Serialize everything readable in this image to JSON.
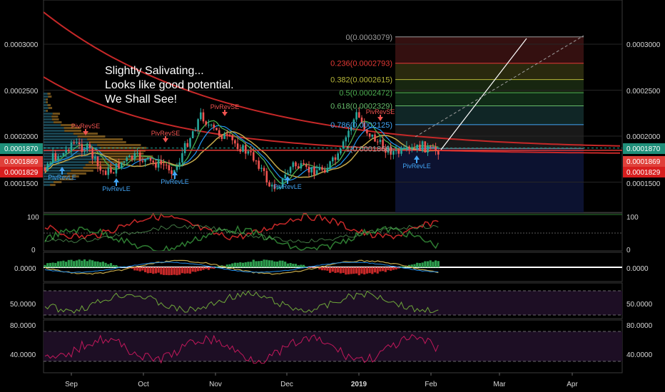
{
  "chart_data": {
    "type": "candlestick",
    "price_panel": {
      "ylim": [
        0.0001215,
        0.000361
      ],
      "yticks": [
        "0.0003000",
        "0.0002500",
        "0.0002000",
        "0.0001500"
      ],
      "current_price": "0.0001870",
      "price_labels": [
        "0.0001870",
        "0.0001869",
        "0.0001829"
      ],
      "annotation": [
        "Slightly Salivating...",
        "Looks like good potential.",
        "We Shall See!"
      ],
      "fib_levels": [
        {
          "label": "0(0.0003079)",
          "value": 0.0003079,
          "color": "#9e9e9e"
        },
        {
          "label": "0.236(0.0002793)",
          "value": 0.0002793,
          "color": "#e53935"
        },
        {
          "label": "0.382(0.0002615)",
          "value": 0.0002615,
          "color": "#b7b73a"
        },
        {
          "label": "0.5(0.0002472)",
          "value": 0.0002472,
          "color": "#4caf50"
        },
        {
          "label": "0.618(0.0002329)",
          "value": 0.0002329,
          "color": "#66bb6a"
        },
        {
          "label": "0.786(0.0002125)",
          "value": 0.0002125,
          "color": "#42a5f5"
        },
        {
          "label": "1(0.0001866)",
          "value": 0.0001866,
          "color": "#9e9e9e"
        }
      ],
      "signals": [
        {
          "label": "PivRevSE",
          "dir": "down",
          "x": 120,
          "y": 190
        },
        {
          "label": "PivRevSE",
          "dir": "down",
          "x": 232,
          "y": 200
        },
        {
          "label": "PivRevSE",
          "dir": "down",
          "x": 315,
          "y": 163
        },
        {
          "label": "PivRevSE",
          "dir": "down",
          "x": 533,
          "y": 170
        },
        {
          "label": "PivRevLE",
          "dir": "up",
          "x": 87,
          "y": 252
        },
        {
          "label": "PivRevLE",
          "dir": "up",
          "x": 163,
          "y": 268
        },
        {
          "label": "PivRevLE",
          "dir": "up",
          "x": 245,
          "y": 258
        },
        {
          "label": "PivRevLE",
          "dir": "up",
          "x": 403,
          "y": 265
        },
        {
          "label": "PivRevLE",
          "dir": "up",
          "x": 584,
          "y": 236
        }
      ]
    },
    "dmi_panel": {
      "ylim": [
        0,
        100
      ],
      "yticks": [
        "100",
        "0"
      ]
    },
    "macd_panel": {
      "yticks": [
        "0.0000"
      ]
    },
    "rsi_panel": {
      "yticks": [
        "50.0000"
      ]
    },
    "stoch_panel": {
      "yticks": [
        "80.0000",
        "40.0000"
      ]
    },
    "x_axis": {
      "labels": [
        {
          "text": "Sep",
          "bold": false
        },
        {
          "text": "Oct",
          "bold": false
        },
        {
          "text": "Nov",
          "bold": false
        },
        {
          "text": "Dec",
          "bold": false
        },
        {
          "text": "2019",
          "bold": true
        },
        {
          "text": "Feb",
          "bold": false
        },
        {
          "text": "Mar",
          "bold": false
        },
        {
          "text": "Apr",
          "bold": false
        }
      ]
    }
  }
}
